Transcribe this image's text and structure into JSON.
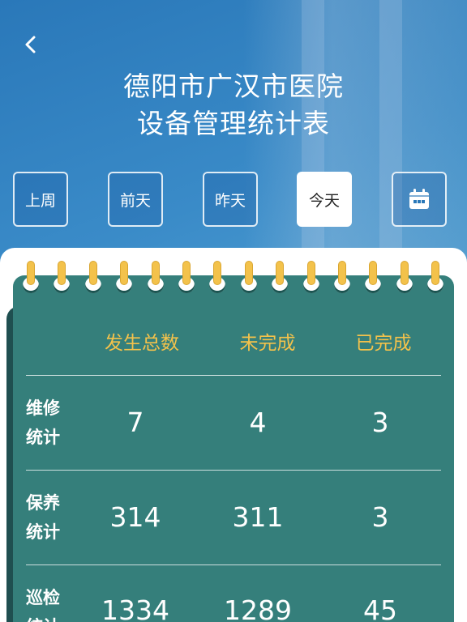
{
  "header": {
    "back_icon": "chevron-left-icon",
    "title_line1": "德阳市广汉市医院",
    "title_line2": "设备管理统计表"
  },
  "date_filters": {
    "items": [
      {
        "label": "上周",
        "active": false
      },
      {
        "label": "前天",
        "active": false
      },
      {
        "label": "昨天",
        "active": false
      },
      {
        "label": "今天",
        "active": true
      }
    ],
    "calendar_icon": "calendar-icon"
  },
  "colors": {
    "board": "#357f7b",
    "header_text": "#f3c24b",
    "ring": "#f3c24b",
    "background": "#2a78b9"
  },
  "table": {
    "columns": [
      "发生总数",
      "未完成",
      "已完成"
    ],
    "rows": [
      {
        "label_line1": "维修",
        "label_line2": "统计",
        "values": [
          "7",
          "4",
          "3"
        ]
      },
      {
        "label_line1": "保养",
        "label_line2": "统计",
        "values": [
          "314",
          "311",
          "3"
        ]
      },
      {
        "label_line1": "巡检",
        "label_line2": "统计",
        "values": [
          "1334",
          "1289",
          "45"
        ]
      }
    ]
  }
}
